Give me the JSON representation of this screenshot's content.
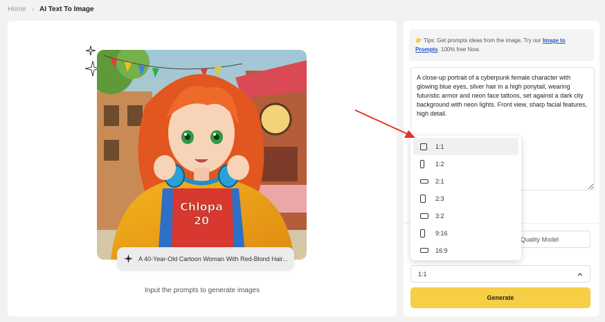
{
  "breadcrumb": {
    "home": "Home",
    "current": "AI Text To Image"
  },
  "preview": {
    "caption": "A 40-Year-Old Cartoon Woman With Red-Blond Hair...",
    "shirt_text_line1": "Chlopa",
    "shirt_text_line2": "20"
  },
  "left_hint": "Input the prompts to generate images",
  "tips": {
    "prefix": "Tips: Get prompts ideas from the image. Try our ",
    "link": "Image to Prompts",
    "suffix": ". 100% free Now."
  },
  "prompt": {
    "value": "A close-up portrait of a cyberpunk female character with glowing blue eyes, silver hair in a high ponytail, wearing futuristic armor and neon face tattoos, set against a dark city background with neon lights. Front view, sharp facial features, high detail."
  },
  "model_select": {
    "value": "Quality Model"
  },
  "ratio_select": {
    "value": "1:1"
  },
  "ratio_options": [
    {
      "label": "1:1",
      "icon": "square-icon",
      "selected": true
    },
    {
      "label": "1:2",
      "icon": "tall-portrait-icon"
    },
    {
      "label": "2:1",
      "icon": "wide-landscape-icon"
    },
    {
      "label": "2:3",
      "icon": "portrait-icon"
    },
    {
      "label": "3:2",
      "icon": "landscape-icon"
    },
    {
      "label": "9:16",
      "icon": "phone-portrait-icon"
    },
    {
      "label": "16:9",
      "icon": "widescreen-icon"
    }
  ],
  "generate_label": "Generate",
  "colors": {
    "accent": "#f7cf46",
    "link": "#2a55c9",
    "arrow": "#e53323"
  }
}
